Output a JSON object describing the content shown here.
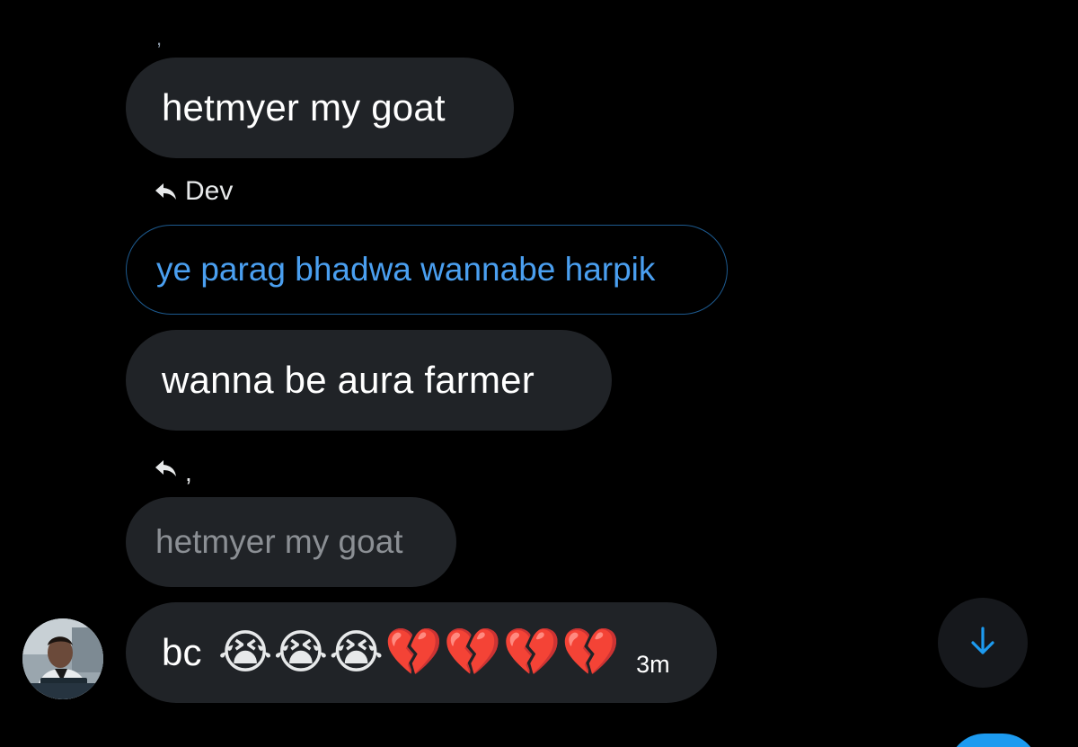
{
  "conversation": {
    "stray_mark": ",",
    "messages": [
      {
        "text": "hetmyer my goat"
      },
      {
        "text": "wanna be aura farmer"
      }
    ],
    "reply_one": {
      "to": "Dev",
      "quoted_text": "ye parag bhadwa wannabe harpik"
    },
    "reply_two": {
      "to": ",",
      "quoted_text": "hetmyer my goat"
    },
    "last_message": {
      "text": "bc",
      "emojis": [
        "😭",
        "😭",
        "😭",
        "💔",
        "💔",
        "💔",
        "💔"
      ],
      "timestamp": "3m"
    }
  },
  "icons": {
    "reply": "reply-arrow-icon",
    "scroll_down": "arrow-down-icon",
    "avatar": "user-avatar"
  },
  "colors": {
    "background": "#000000",
    "bubble": "#202327",
    "accent": "#1d9bf0",
    "quote_text": "#4a9ff0",
    "muted_text": "#8b8f94"
  }
}
